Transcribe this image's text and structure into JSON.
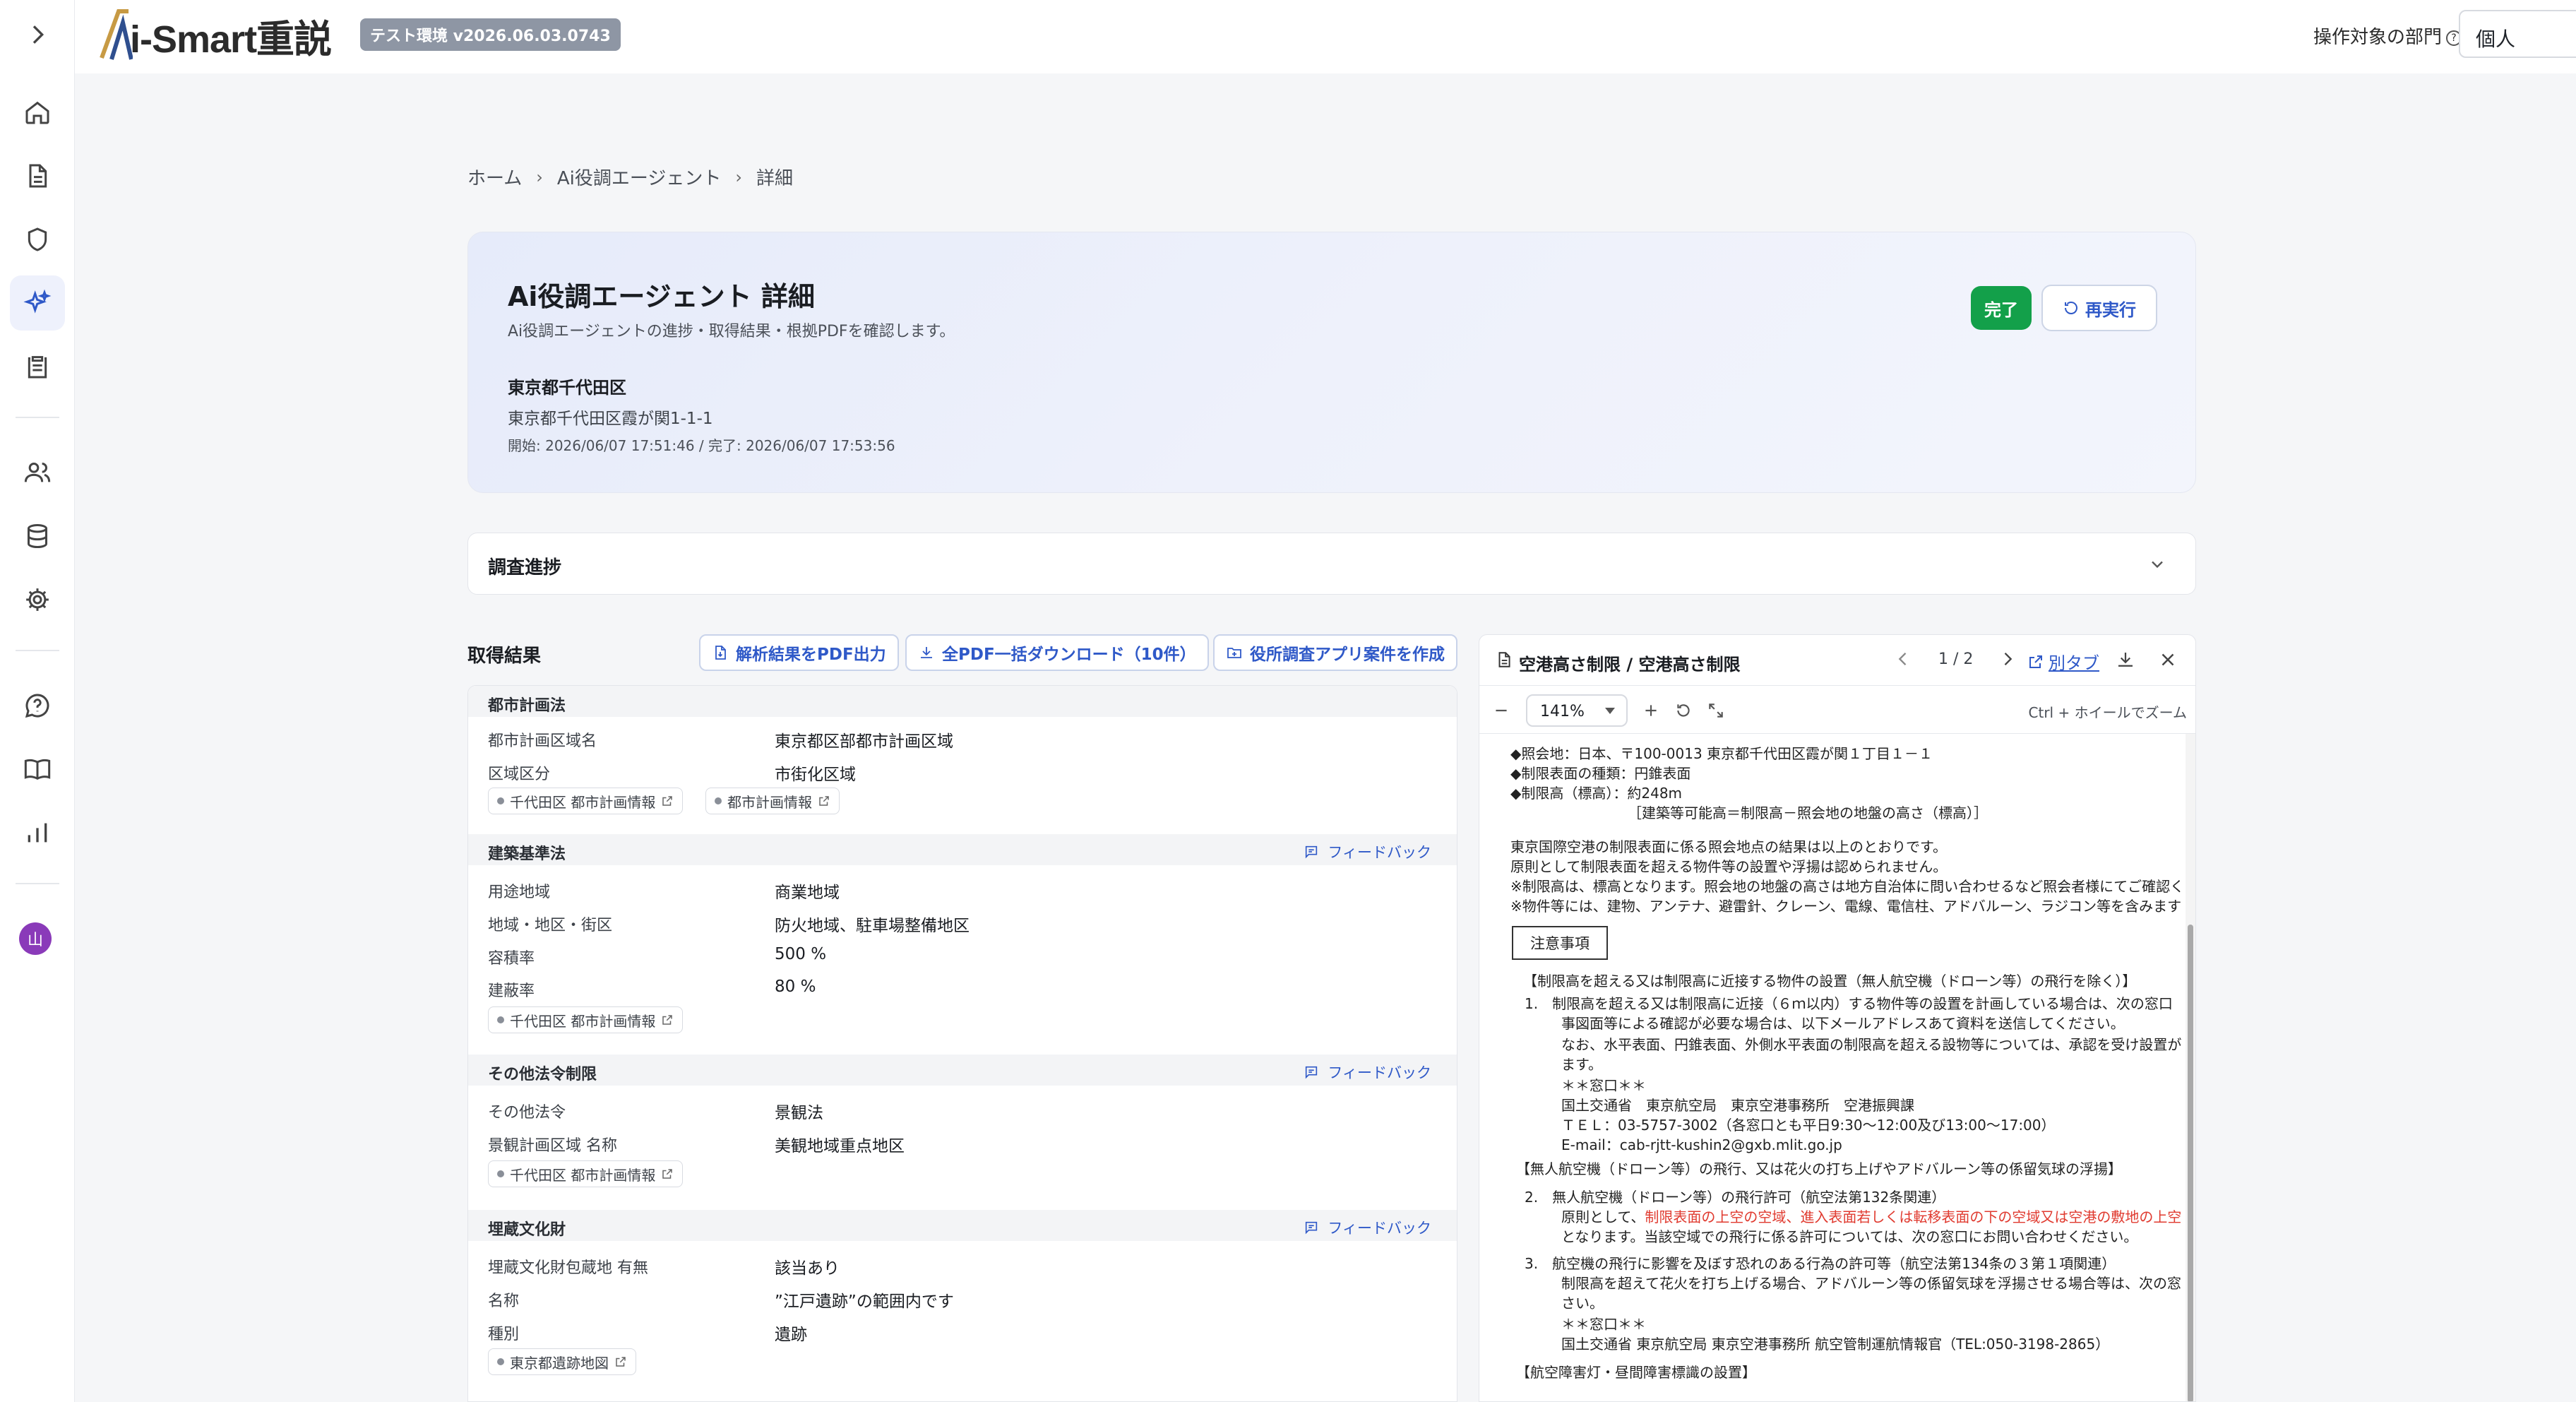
{
  "app": {
    "logo_text": "i-Smart重説",
    "env_badge": "テスト環境 v2026.06.03.0743"
  },
  "header": {
    "dept_label": "操作対象の部門",
    "dept_value": "個人"
  },
  "sidebar": {
    "avatar_letter": "山"
  },
  "breadcrumb": [
    "ホーム",
    "Ai役調エージェント",
    "詳細"
  ],
  "hero": {
    "title": "Ai役調エージェント 詳細",
    "subtitle": "Ai役調エージェントの進捗・取得結果・根拠PDFを確認します。",
    "location": "東京都千代田区",
    "address": "東京都千代田区霞が関1-1-1",
    "time": "開始: 2026/06/07 17:51:46 / 完了: 2026/06/07 17:53:56",
    "status": "完了",
    "rerun": "再実行"
  },
  "progress": {
    "title": "調査進捗"
  },
  "results": {
    "title": "取得結果",
    "actions": [
      "解析結果をPDF出力",
      "全PDF一括ダウンロード（10件）",
      "役所調査アプリ案件を作成"
    ],
    "feedback_label": "フィードバック",
    "sections": [
      {
        "title": "都市計画法",
        "rows": [
          [
            "都市計画区域名",
            "東京都区部都市計画区域"
          ],
          [
            "区域区分",
            "市街化区域"
          ]
        ],
        "chips": [
          "千代田区 都市計画情報",
          "都市計画情報"
        ]
      },
      {
        "title": "建築基準法",
        "rows": [
          [
            "用途地域",
            "商業地域"
          ],
          [
            "地域・地区・街区",
            "防火地域、駐車場整備地区"
          ],
          [
            "容積率",
            "500 %"
          ],
          [
            "建蔽率",
            "80 %"
          ]
        ],
        "chips": [
          "千代田区 都市計画情報"
        ]
      },
      {
        "title": "その他法令制限",
        "rows": [
          [
            "その他法令",
            "景観法"
          ],
          [
            "景観計画区域 名称",
            "美観地域重点地区"
          ]
        ],
        "chips": [
          "千代田区 都市計画情報"
        ]
      },
      {
        "title": "埋蔵文化財",
        "rows": [
          [
            "埋蔵文化財包蔵地 有無",
            "該当あり"
          ],
          [
            "名称",
            "”江戸遺跡”の範囲内です"
          ],
          [
            "種別",
            "遺跡"
          ]
        ],
        "chips": [
          "東京都遺跡地図"
        ]
      }
    ]
  },
  "viewer": {
    "title": "空港高さ制限 / 空港高さ制限",
    "page": "1 / 2",
    "open_tab": "別タブ",
    "zoom": "141%",
    "hint": "Ctrl + ホイールでズーム",
    "lines": [
      "◆照会地：日本、〒100-0013 東京都千代田区霞が関１丁目１－１",
      "◆制限表面の種類：円錐表面",
      "◆制限高（標高）：約248m",
      "［建築等可能高＝制限高－照会地の地盤の高さ（標高）］",
      "東京国際空港の制限表面に係る照会地点の結果は以上のとおりです。",
      "原則として制限表面を超える物件等の設置や浮揚は認められません。",
      "※制限高は、標高となります。照会地の地盤の高さは地方自治体に問い合わせるなど照会者様にてご確認く",
      "※物件等には、建物、アンテナ、避雷針、クレーン、電線、電信柱、アドバルーン、ラジコン等を含みます",
      "【制限高を超える又は制限高に近接する物件の設置（無人航空機（ドローン等）の飛行を除く）】",
      "1.　制限高を超える又は制限高に近接（６ｍ以内）する物件等の設置を計画している場合は、次の窓口",
      "事図面等による確認が必要な場合は、以下メールアドレスあて資料を送信してください。",
      "なお、水平表面、円錐表面、外側水平表面の制限高を超える設物等については、承認を受け設置が",
      "ます。",
      "＊＊窓口＊＊",
      "国土交通省　東京航空局　東京空港事務所　空港振興課",
      "ＴＥＬ：03-5757-3002（各窓口とも平日9:30～12:00及び13:00～17:00）",
      "E-mail：cab-rjtt-kushin2@gxb.mlit.go.jp",
      "【無人航空機（ドローン等）の飛行、又は花火の打ち上げやアドバルーン等の係留気球の浮揚】",
      "2.　無人航空機（ドローン等）の飛行許可（航空法第132条関連）",
      "原則として、",
      "制限表面の上空の空域、進入表面若しくは転移表面の下の空域又は空港の敷地の上空",
      "となります。当該空域での飛行に係る許可については、次の窓口にお問い合わせください。",
      "3.　航空機の飛行に影響を及ぼす恐れのある行為の許可等（航空法第134条の３第１項関連）",
      "制限高を超えて花火を打ち上げる場合、アドバルーン等の係留気球を浮揚させる場合等は、次の窓",
      "さい。",
      "＊＊窓口＊＊",
      "国土交通省 東京航空局 東京空港事務所 航空管制運航情報官（TEL:050-3198-2865）",
      "【航空障害灯・昼間障害標識の設置】"
    ],
    "notice_box": "注意事項"
  }
}
